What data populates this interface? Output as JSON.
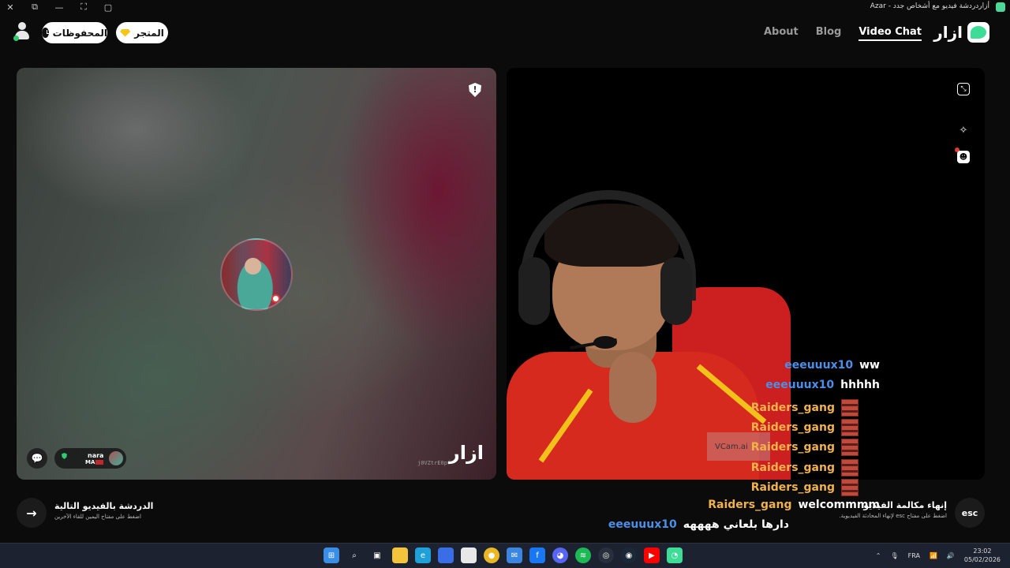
{
  "window": {
    "title": "أزاردردشة فيديو مع أشخاص جدد - Azar",
    "controls": [
      "✕",
      "⧉",
      "—",
      "⛶",
      "▢"
    ]
  },
  "header": {
    "saved_label": "المحفوظات",
    "store_label": "المتجر",
    "nav": {
      "about": "About",
      "blog": "Blog",
      "video_chat": "Video Chat"
    },
    "brand": "ازار"
  },
  "left_panel": {
    "peer": {
      "name": "nara",
      "country": "MA"
    },
    "uid": "j0VZtrE0pf",
    "watermark": "ازار"
  },
  "right_panel": {
    "vcam_text": "VCam.ai",
    "chat_overlay": [
      {
        "user": "eeeuuux10",
        "msg": "ww",
        "color": "#4a8fe8",
        "img": false
      },
      {
        "user": "eeeuuux10",
        "msg": "hhhhh",
        "color": "#4a8fe8",
        "img": false
      },
      {
        "user": "Raiders_gang",
        "msg": "",
        "color": "#f0b24a",
        "img": true
      },
      {
        "user": "Raiders_gang",
        "msg": "",
        "color": "#f0b24a",
        "img": true
      },
      {
        "user": "Raiders_gang",
        "msg": "",
        "color": "#f0b24a",
        "img": true
      },
      {
        "user": "Raiders_gang",
        "msg": "",
        "color": "#f0b24a",
        "img": true
      },
      {
        "user": "Raiders_gang",
        "msg": "",
        "color": "#f0b24a",
        "img": true
      },
      {
        "user": "Raiders_gang",
        "msg": "welcommmm",
        "color": "#f0b24a",
        "img": false
      },
      {
        "user": "eeeuuux10",
        "msg": "دارها بلعاني ههههه",
        "color": "#4a8fe8",
        "img": false
      }
    ]
  },
  "bottom": {
    "next_title": "الدردشة بالفيديو التالية",
    "next_sub": "اضغط على مفتاح اليمين للقاء الآخرين",
    "end_title": "إنهاء مكالمة الفيديو",
    "end_sub": "اضغط على مفتاح esc لإنهاء المحادثة الفيديوية.",
    "end_key": "esc"
  },
  "taskbar": {
    "lang": "FRA",
    "time": "23:02",
    "date": "05/02/2026",
    "icons": [
      "windows-start",
      "search",
      "task-view",
      "file-explorer",
      "edge",
      "store",
      "notepad",
      "chrome",
      "mail",
      "facebook",
      "discord",
      "spotify",
      "steam-companion",
      "steam",
      "youtube",
      "azar"
    ]
  }
}
